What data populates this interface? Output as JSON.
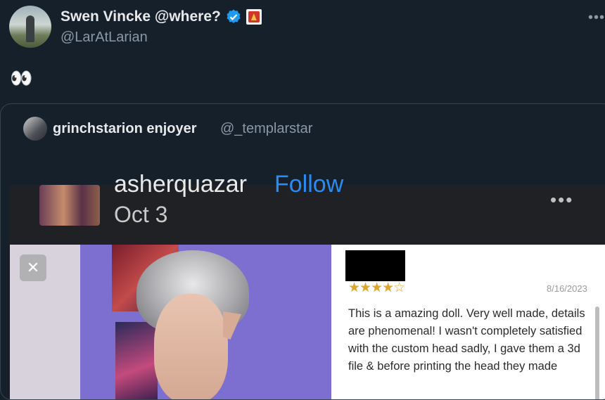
{
  "tweet": {
    "author_name": "Swen Vincke @where?",
    "author_handle": "@LarAtLarian",
    "text": "👀",
    "more": "•••"
  },
  "quote": {
    "author_name": "grinchstarion enjoyer",
    "author_handle": "@_templarstar"
  },
  "media": {
    "post": {
      "username": "asherquazar",
      "follow_label": "Follow",
      "date": "Oct 3",
      "more": "•••"
    },
    "close_label": "✕",
    "review": {
      "rating": 4,
      "stars_filled": "★★★★",
      "stars_empty": "☆",
      "date": "8/16/2023",
      "text": "This is a amazing doll. Very well made, details are phenomenal! I wasn't completely satisfied with the custom head sadly, I gave them a 3d file & before printing the head they made"
    }
  },
  "colors": {
    "background": "#15202b",
    "verified": "#1d9bf0",
    "follow": "#2a8bf2",
    "stars": "#e0a52d"
  }
}
